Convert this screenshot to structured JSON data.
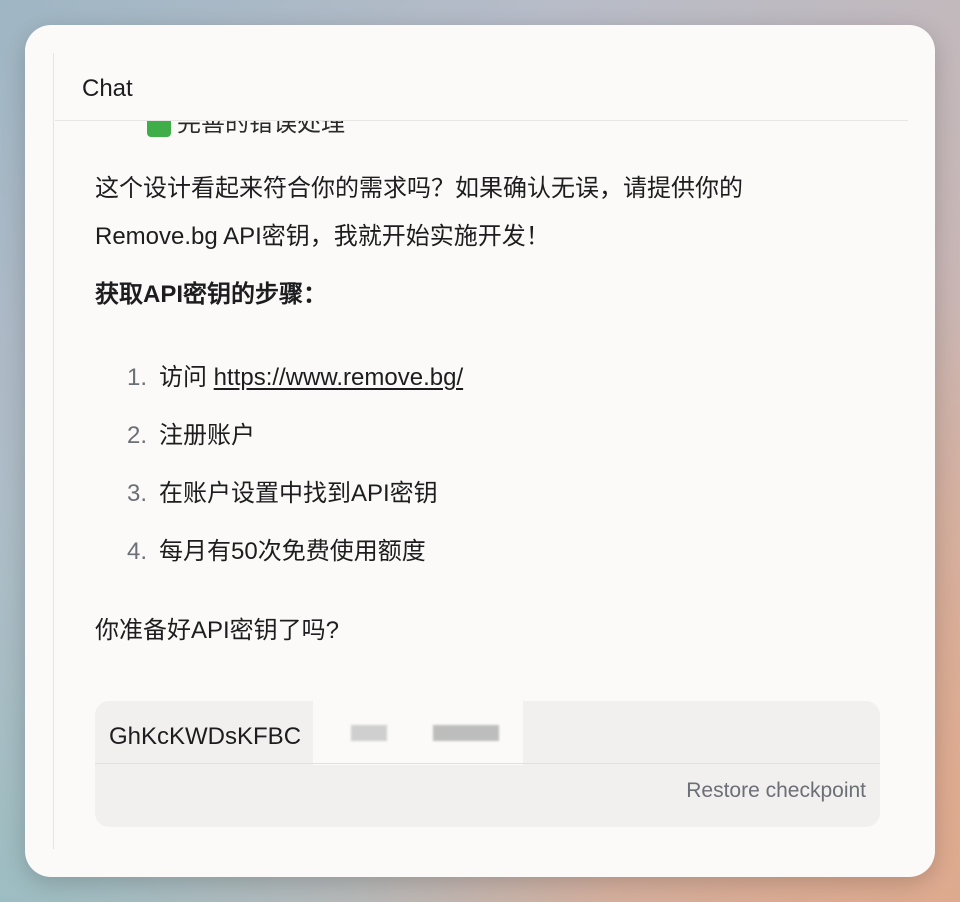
{
  "panel": {
    "title": "Chat"
  },
  "message": {
    "peek_text": "完善的错误处理",
    "paragraph_line1": "这个设计看起来符合你的需求吗？如果确认无误，请提供你的",
    "paragraph_line2": "Remove.bg API密钥，我就开始实施开发！",
    "steps_heading": "获取API密钥的步骤：",
    "steps": [
      {
        "num": "1.",
        "prefix": "访问 ",
        "link": "https://www.remove.bg/"
      },
      {
        "num": "2.",
        "text": "注册账户"
      },
      {
        "num": "3.",
        "text": "在账户设置中找到API密钥"
      },
      {
        "num": "4.",
        "text": "每月有50次免费使用额度"
      }
    ],
    "question": "你准备好API密钥了吗?"
  },
  "user_input": {
    "value": "GhKcKWDsKFBC",
    "restore_label": "Restore checkpoint"
  },
  "colors": {
    "accent_check": "#3fae49",
    "muted_text": "#6b6f76"
  }
}
